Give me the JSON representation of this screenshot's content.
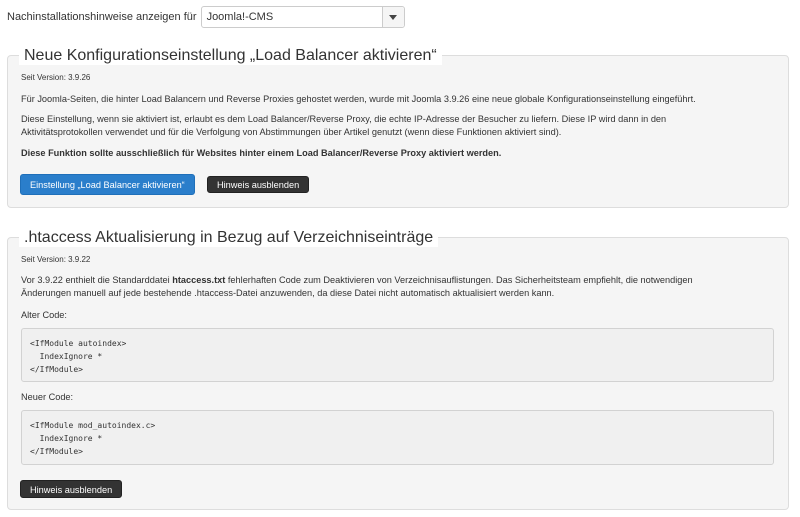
{
  "filter": {
    "label": "Nachinstallationshinweise anzeigen für",
    "selected": "Joomla!-CMS"
  },
  "notices": [
    {
      "title": "Neue Konfigurationseinstellung „Load Balancer aktivieren“",
      "version": "Seit Version: 3.9.26",
      "para1": "Für Joomla-Seiten, die hinter Load Balancern und Reverse Proxies gehostet werden, wurde mit Joomla 3.9.26 eine neue globale Konfigurationseinstellung eingeführt.",
      "para2a": "Diese Einstellung, wenn sie aktiviert ist, erlaubt es dem Load Balancer/Reverse Proxy, die echte IP-Adresse der Besucher zu liefern. Diese IP wird dann in den",
      "para2b": "Aktivitätsprotokollen verwendet und für die Verfolgung von Abstimmungen über Artikel genutzt (wenn diese Funktionen aktiviert sind).",
      "para3": "Diese Funktion sollte ausschließlich für Websites hinter einem Load Balancer/Reverse Proxy aktiviert werden.",
      "action_button": "Einstellung „Load Balancer aktivieren“",
      "hide_button": "Hinweis ausblenden"
    },
    {
      "title": ".htaccess Aktualisierung in Bezug auf Verzeichniseinträge",
      "version": "Seit Version: 3.9.22",
      "para1_pre": "Vor 3.9.22 enthielt die Standarddatei ",
      "para1_bold": "htaccess.txt",
      "para1_post": " fehlerhaften Code zum Deaktivieren von Verzeichnisauflistungen. Das Sicherheitsteam empfiehlt, die notwendigen",
      "para1_line2": "Änderungen manuell auf jede bestehende .htaccess-Datei anzuwenden, da diese Datei nicht automatisch aktualisiert werden kann.",
      "old_label": "Alter Code:",
      "old_code": "<IfModule autoindex>\n  IndexIgnore *\n</IfModule>",
      "new_label": "Neuer Code:",
      "new_code": "<IfModule mod_autoindex.c>\n  IndexIgnore *\n</IfModule>",
      "hide_button": "Hinweis ausblenden"
    }
  ]
}
